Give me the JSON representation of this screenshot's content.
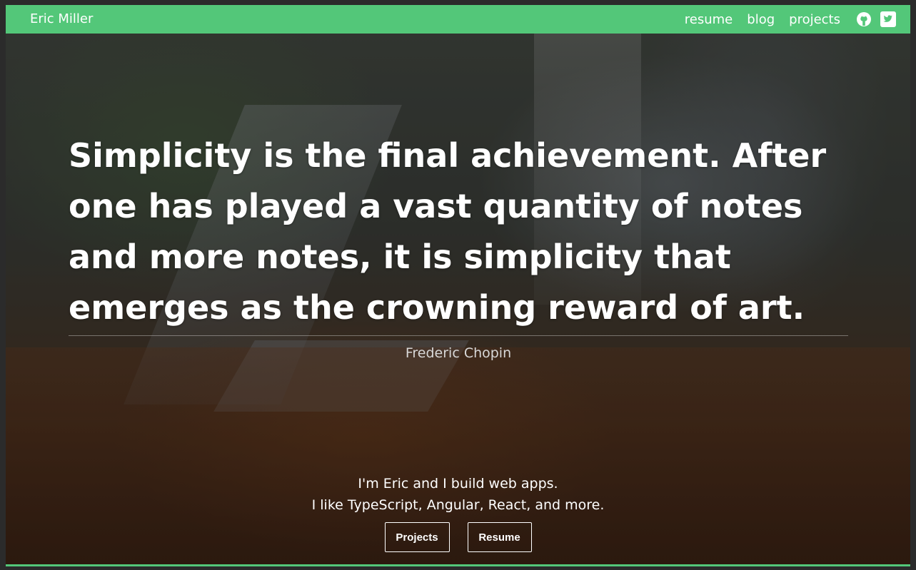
{
  "navbar": {
    "brand": "Eric Miller",
    "links": [
      "resume",
      "blog",
      "projects"
    ],
    "icons": [
      "github-icon",
      "twitter-icon"
    ],
    "color": "#53c779"
  },
  "hero": {
    "quote": "Simplicity is the final achievement. After one has played a vast quantity of notes and more notes, it is simplicity that emerges as the crowning reward of art.",
    "author": "Frederic Chopin",
    "intro_line1": "I'm Eric and I build web apps.",
    "intro_line2": "I like TypeScript, Angular, React, and more.",
    "buttons": {
      "projects": "Projects",
      "resume": "Resume"
    }
  }
}
